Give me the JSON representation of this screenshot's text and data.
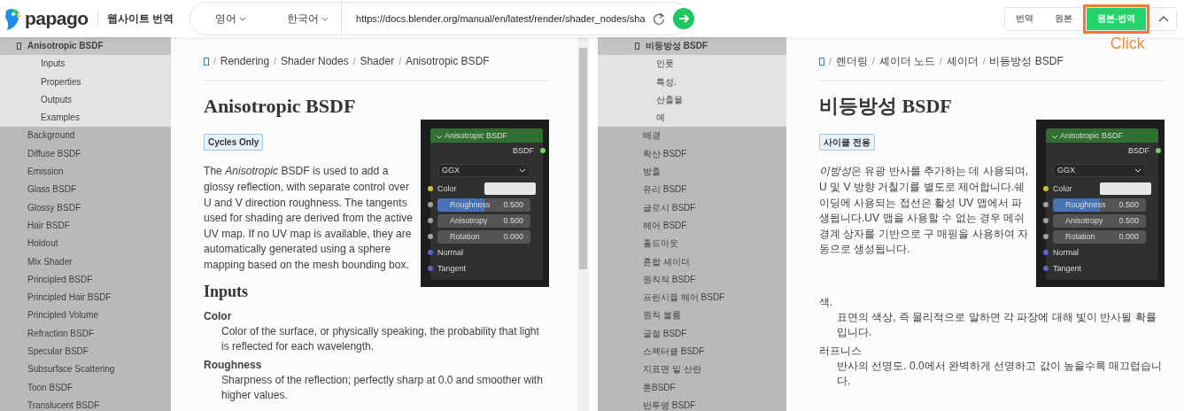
{
  "app": {
    "logo": "papago",
    "title": "웹사이트 번역"
  },
  "translator": {
    "source_language": "영어",
    "target_language": "한국어",
    "url": "https://docs.blender.org/manual/en/latest/render/shader_nodes/sha"
  },
  "view_modes": [
    {
      "label": "번역",
      "selected": false,
      "highlighted": false
    },
    {
      "label": "원본",
      "selected": false,
      "highlighted": false
    },
    {
      "label": "원본-번역",
      "selected": true,
      "highlighted": true
    }
  ],
  "annotation": {
    "label": "Click"
  },
  "panes": [
    {
      "scrollbar": true,
      "sidebar": {
        "current": {
          "label": "Anisotropic BSDF",
          "expanded": true,
          "children": [
            "Inputs",
            "Properties",
            "Outputs",
            "Examples"
          ]
        },
        "items": [
          "Background",
          "Diffuse BSDF",
          "Emission",
          "Glass BSDF",
          "Glossy BSDF",
          "Hair BSDF",
          "Holdout",
          "Mix Shader",
          "Principled BSDF",
          "Principled Hair BSDF",
          "Principled Volume",
          "Refraction BSDF",
          "Specular BSDF",
          "Subsurface Scattering",
          "Toon BSDF",
          "Translucent BSDF"
        ]
      },
      "breadcrumb": [
        {
          "kind": "home"
        },
        {
          "kind": "link",
          "separator": "/",
          "label": "Rendering"
        },
        {
          "kind": "link",
          "separator": "/",
          "label": "Shader Nodes"
        },
        {
          "kind": "link",
          "separator": "/",
          "label": "Shader"
        },
        {
          "kind": "current",
          "separator": "/",
          "label": "Anisotropic BSDF"
        }
      ],
      "title": "Anisotropic BSDF",
      "badge": "Cycles Only",
      "intro": [
        {
          "text": "The ",
          "italic": false
        },
        {
          "text": "Anisotropic",
          "italic": true
        },
        {
          "text": " BSDF is used to add a glossy reflection, with separate control over U and V direction roughness. The tangents used for shading are derived from the active UV map. If no UV map is available, they are automatically generated using a sphere mapping based on the mesh bounding box.",
          "italic": false
        }
      ],
      "node": {
        "title": "Anisotropic BSDF",
        "output": {
          "label": "BSDF",
          "color": "#6ccf5f"
        },
        "distribution": "GGX",
        "inputs": [
          {
            "kind": "color",
            "label": "Color",
            "color": "#c7c729"
          },
          {
            "kind": "factor",
            "label": "Roughness",
            "value": "0.500",
            "level": 0.5,
            "color": "#a1a1a1"
          },
          {
            "kind": "value",
            "label": "Anisotropy",
            "value": "0.500",
            "level": 0,
            "color": "#a1a1a1"
          },
          {
            "kind": "value",
            "label": "Rotation",
            "value": "0.000",
            "level": 0,
            "color": "#a1a1a1"
          },
          {
            "kind": "vector",
            "label": "Normal",
            "color": "#6363c7"
          },
          {
            "kind": "vector",
            "label": "Tangent",
            "color": "#6363c7"
          }
        ]
      },
      "section_heading": "Inputs",
      "definitions": [
        {
          "term": "Color",
          "description": "Color of the surface, or physically speaking, the probability that light is reflected for each wavelength."
        },
        {
          "term": "Roughness",
          "description": "Sharpness of the reflection; perfectly sharp at 0.0 and smoother with higher values."
        }
      ]
    },
    {
      "scrollbar": false,
      "sidebar": {
        "current": {
          "label": "비등방성 BSDF",
          "expanded": true,
          "children": [
            "인풋",
            "특성.",
            "산출물",
            "예"
          ]
        },
        "items": [
          "배경",
          "확산 BSDF",
          "방출",
          "유리 BSDF",
          "글로시 BSDF",
          "헤어 BSDF",
          "홀드아웃",
          "혼합 셰이더",
          "원칙적 BSDF",
          "프린시플 헤어 BSDF",
          "원칙 볼륨",
          "굴절 BSDF",
          "스펙터클 BSDF",
          "지표면 밑 산란",
          "툰BSDF",
          "반투명 BSDF"
        ]
      },
      "breadcrumb": [
        {
          "kind": "home"
        },
        {
          "kind": "link",
          "separator": "/",
          "label": "렌더링"
        },
        {
          "kind": "link",
          "separator": "/",
          "label": "셰이더 노드"
        },
        {
          "kind": "link",
          "separator": "/",
          "label": "셰이더"
        },
        {
          "kind": "current",
          "separator": "/",
          "label": "비등방성 BSDF"
        }
      ],
      "title": "비등방성 BSDF",
      "badge": "사이클 전용",
      "intro": [
        {
          "text": "이방성",
          "italic": true
        },
        {
          "text": "은 유광 반사를 추가하는 데 사용되며, U 및 V 방향 거칠기를 별도로 제어합니다.쉐이딩에 사용되는 접선은 활성 UV 맵에서 파생됩니다.UV 맵을 사용할 수 없는 경우 메쉬 경계 상자를 기반으로 구 매핑을 사용하여 자동으로 생성됩니다.",
          "italic": false
        }
      ],
      "node": {
        "title": "Anisotropic BSDF",
        "output": {
          "label": "BSDF",
          "color": "#6ccf5f"
        },
        "distribution": "GGX",
        "inputs": [
          {
            "kind": "color",
            "label": "Color",
            "color": "#c7c729"
          },
          {
            "kind": "factor",
            "label": "Roughness",
            "value": "0.500",
            "level": 0.5,
            "color": "#a1a1a1"
          },
          {
            "kind": "value",
            "label": "Anisotropy",
            "value": "0.500",
            "level": 0,
            "color": "#a1a1a1"
          },
          {
            "kind": "value",
            "label": "Rotation",
            "value": "0.000",
            "level": 0,
            "color": "#a1a1a1"
          },
          {
            "kind": "vector",
            "label": "Normal",
            "color": "#6363c7"
          },
          {
            "kind": "vector",
            "label": "Tangent",
            "color": "#6363c7"
          }
        ]
      },
      "definitions": [
        {
          "term": "색.",
          "description": "표면의 색상, 즉 물리적으로 말하면 각 파장에 대해 빛이 반사될 확률입니다."
        },
        {
          "term": "러프니스",
          "description": "반사의 선명도. 0.0에서 완벽하게 선명하고 값이 높을수록 매끄럽습니다."
        }
      ]
    }
  ]
}
